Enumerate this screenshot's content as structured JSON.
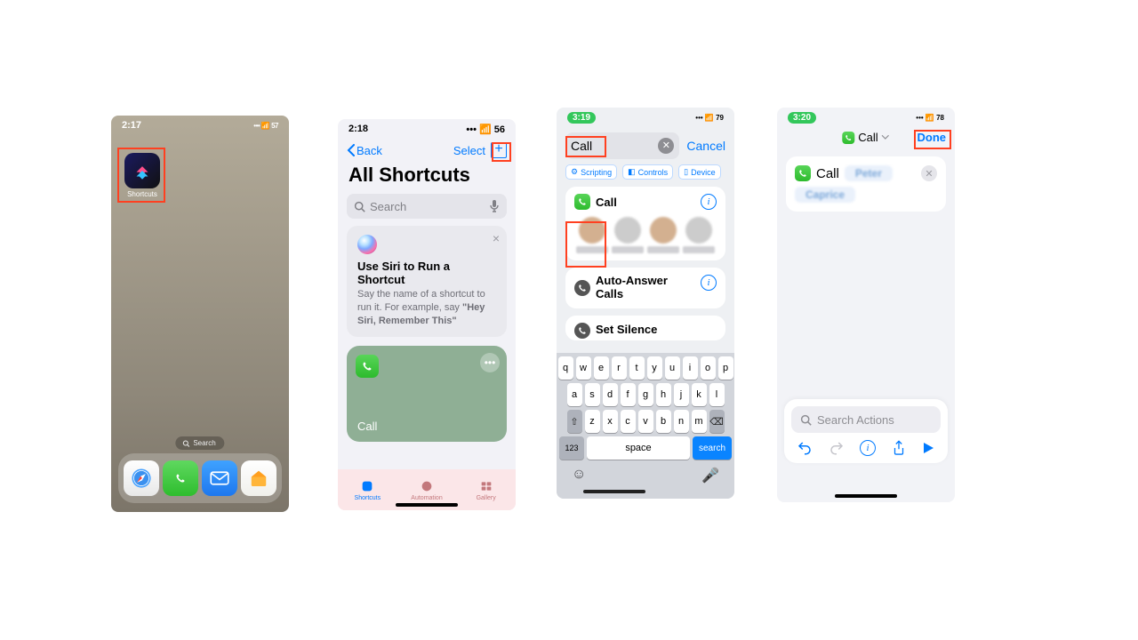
{
  "screen1": {
    "time": "2:17",
    "indicators": "􀙇 􀛨 57",
    "app": {
      "label": "Shortcuts"
    },
    "spotlight": "Search"
  },
  "screen2": {
    "time": "2:18",
    "back": "Back",
    "select": "Select",
    "title": "All Shortcuts",
    "search_ph": "Search",
    "siri": {
      "title": "Use Siri to Run a Shortcut",
      "desc_a": "Say the name of a shortcut to run it. For example, say ",
      "desc_b": "\"Hey Siri, Remember This\""
    },
    "card_label": "Call",
    "tabs": {
      "a": "Shortcuts",
      "b": "Automation",
      "c": "Gallery"
    }
  },
  "screen3": {
    "time": "3:19",
    "search_value": "Call",
    "cancel": "Cancel",
    "chips": {
      "a": "Scripting",
      "b": "Controls",
      "c": "Device"
    },
    "result_title": "Call",
    "r2_a": "Auto-Answer ",
    "r2_b": "Calls",
    "r3_a": "Set Silence",
    "kb": {
      "row1": [
        "q",
        "w",
        "e",
        "r",
        "t",
        "y",
        "u",
        "i",
        "o",
        "p"
      ],
      "row2": [
        "a",
        "s",
        "d",
        "f",
        "g",
        "h",
        "j",
        "k",
        "l"
      ],
      "row3": [
        "z",
        "x",
        "c",
        "v",
        "b",
        "n",
        "m"
      ],
      "n123": "123",
      "space": "space",
      "search": "search"
    }
  },
  "screen4": {
    "time": "3:20",
    "title": "Call",
    "done": "Done",
    "action_label": "Call",
    "search_actions": "Search Actions"
  }
}
